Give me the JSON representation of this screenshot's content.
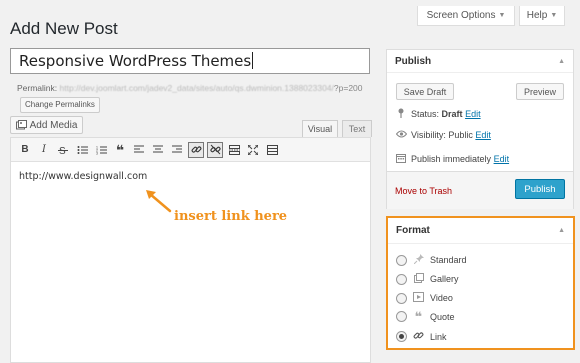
{
  "header": {
    "screen_options_label": "Screen Options",
    "help_label": "Help",
    "page_title": "Add New Post"
  },
  "post": {
    "title_value": "Responsive WordPress Themes",
    "permalink_label": "Permalink:",
    "permalink_url": "http://dev.joomlart.com/jadev2_data/sites/auto/qs.dwminion.1388023304/",
    "permalink_suffix": "?p=200",
    "change_permalinks_label": "Change Permalinks"
  },
  "editor": {
    "add_media_label": "Add Media",
    "tab_visual": "Visual",
    "tab_text": "Text",
    "content": "http://www.designwall.com",
    "toolbar": {
      "bold": "B",
      "italic": "I"
    }
  },
  "annotation": {
    "text": "insert link here",
    "color": "#f0921e"
  },
  "publish": {
    "title": "Publish",
    "save_draft_label": "Save Draft",
    "preview_label": "Preview",
    "status_label": "Status:",
    "status_value": "Draft",
    "visibility_label": "Visibility:",
    "visibility_value": "Public",
    "publish_label": "Publish",
    "publish_value": "immediately",
    "edit_label": "Edit",
    "trash_label": "Move to Trash",
    "publish_button_label": "Publish",
    "accent_color": "#2ea2cc"
  },
  "format": {
    "title": "Format",
    "options": [
      {
        "label": "Standard",
        "icon": "pin-icon",
        "checked": false
      },
      {
        "label": "Gallery",
        "icon": "gallery-icon",
        "checked": false
      },
      {
        "label": "Video",
        "icon": "video-icon",
        "checked": false
      },
      {
        "label": "Quote",
        "icon": "quote-icon",
        "checked": false
      },
      {
        "label": "Link",
        "icon": "link-icon",
        "checked": true
      }
    ],
    "highlight_color": "#f0921e"
  }
}
